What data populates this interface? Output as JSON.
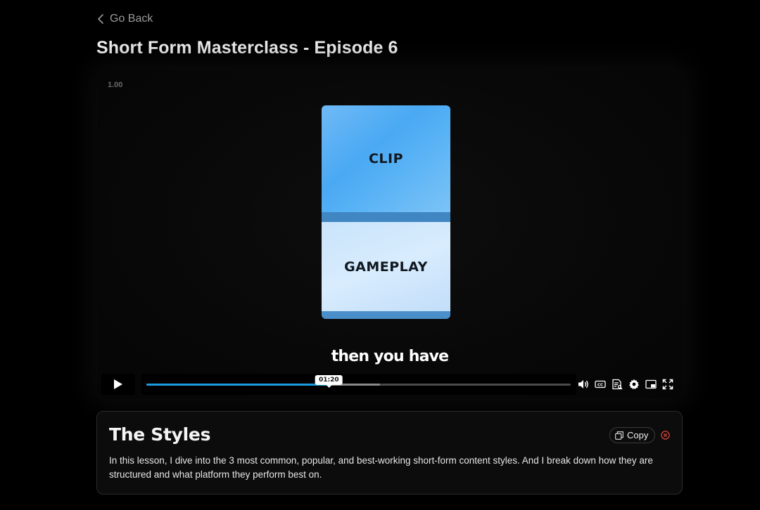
{
  "nav": {
    "back_label": "Go Back"
  },
  "page": {
    "title": "Short Form Masterclass - Episode 6"
  },
  "video": {
    "speed_label": "1.00",
    "phone_top_label": "CLIP",
    "phone_bottom_label": "GAMEPLAY",
    "caption": "then you have",
    "current_time": "01:20",
    "progress_fraction": 0.43,
    "buffered_fraction": 0.55,
    "controls": [
      "play-icon",
      "volume-icon",
      "closed-captions-icon",
      "transcript-icon",
      "settings-icon",
      "picture-in-picture-icon",
      "fullscreen-icon"
    ],
    "accent_color": "#1b9be0"
  },
  "lesson": {
    "title": "The Styles",
    "copy_label": "Copy",
    "close_color": "#e0453a",
    "description": "In this lesson, I dive into the 3 most common, popular, and best-working short-form content styles. And I break down how they are structured and what platform they perform best on."
  }
}
